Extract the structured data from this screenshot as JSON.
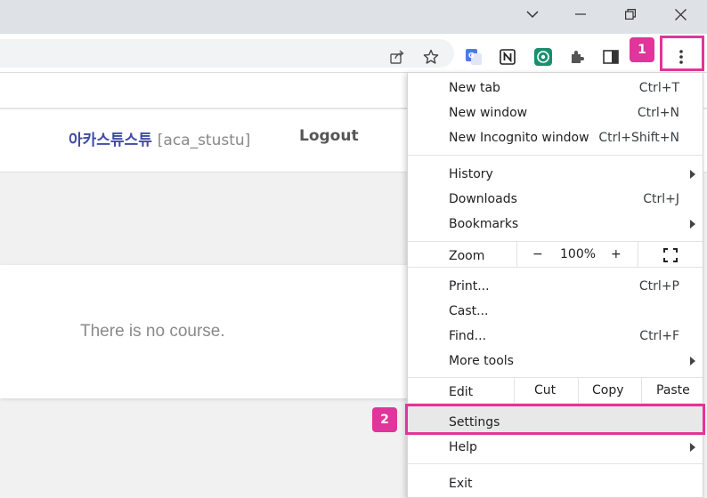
{
  "window": {
    "minimize_symbol": "—"
  },
  "page": {
    "user_name": "아카스튜스튜",
    "user_id": "[aca_stustu]",
    "logout": "Logout",
    "empty_message": "There is no course."
  },
  "menu": {
    "new_tab": {
      "label": "New tab",
      "shortcut": "Ctrl+T"
    },
    "new_window": {
      "label": "New window",
      "shortcut": "Ctrl+N"
    },
    "new_incognito": {
      "label": "New Incognito window",
      "shortcut": "Ctrl+Shift+N"
    },
    "history": {
      "label": "History"
    },
    "downloads": {
      "label": "Downloads",
      "shortcut": "Ctrl+J"
    },
    "bookmarks": {
      "label": "Bookmarks"
    },
    "zoom": {
      "label": "Zoom",
      "minus": "−",
      "value": "100%",
      "plus": "+"
    },
    "print": {
      "label": "Print...",
      "shortcut": "Ctrl+P"
    },
    "cast": {
      "label": "Cast..."
    },
    "find": {
      "label": "Find...",
      "shortcut": "Ctrl+F"
    },
    "more_tools": {
      "label": "More tools"
    },
    "edit": {
      "label": "Edit",
      "cut": "Cut",
      "copy": "Copy",
      "paste": "Paste"
    },
    "settings": {
      "label": "Settings"
    },
    "help": {
      "label": "Help"
    },
    "exit": {
      "label": "Exit"
    }
  },
  "callouts": {
    "step1": "1",
    "step2": "2",
    "color": "#e0359a"
  }
}
